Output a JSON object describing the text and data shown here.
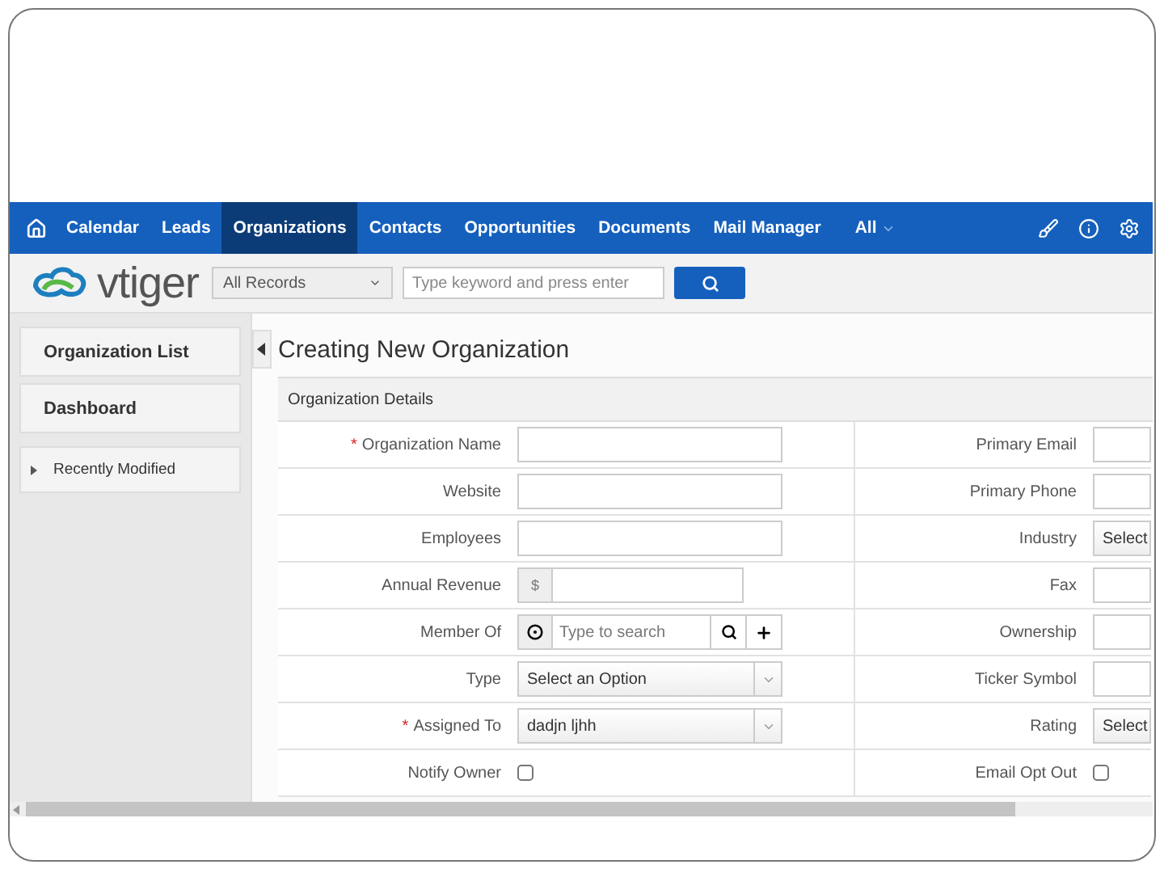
{
  "nav": {
    "items": [
      {
        "label": "Calendar",
        "selected": false
      },
      {
        "label": "Leads",
        "selected": false
      },
      {
        "label": "Organizations",
        "selected": true
      },
      {
        "label": "Contacts",
        "selected": false
      },
      {
        "label": "Opportunities",
        "selected": false
      },
      {
        "label": "Documents",
        "selected": false
      },
      {
        "label": "Mail Manager",
        "selected": false
      }
    ],
    "all_menu": "All"
  },
  "logo": "vtiger",
  "search": {
    "scope": "All Records",
    "placeholder": "Type keyword and press enter"
  },
  "sidebar": {
    "items": [
      {
        "label": "Organization List",
        "kind": "button"
      },
      {
        "label": "Dashboard",
        "kind": "button"
      },
      {
        "label": "Recently Modified",
        "kind": "collapsible"
      }
    ]
  },
  "page_title": "Creating New Organization",
  "section": "Organization Details",
  "left_fields": [
    {
      "required_mark": "*",
      "label": "Organization Name",
      "kind": "text"
    },
    {
      "label": "Website",
      "kind": "text"
    },
    {
      "label": "Employees",
      "kind": "text"
    },
    {
      "label": "Annual Revenue",
      "kind": "currency",
      "prefix": "$"
    },
    {
      "label": "Member Of",
      "kind": "reference",
      "placeholder": "Type to search"
    },
    {
      "label": "Type",
      "kind": "select",
      "value": "Select an Option"
    },
    {
      "required_mark": "*",
      "label": "Assigned To",
      "kind": "select",
      "value": "dadjn ljhh"
    },
    {
      "label": "Notify Owner",
      "kind": "checkbox",
      "checked": false
    }
  ],
  "right_fields": [
    {
      "label": "Primary Email",
      "kind": "text"
    },
    {
      "label": "Primary Phone",
      "kind": "text"
    },
    {
      "label": "Industry",
      "kind": "select",
      "value": "Select"
    },
    {
      "label": "Fax",
      "kind": "text"
    },
    {
      "label": "Ownership",
      "kind": "text"
    },
    {
      "label": "Ticker Symbol",
      "kind": "text"
    },
    {
      "label": "Rating",
      "kind": "select",
      "value": "Select"
    },
    {
      "label": "Email Opt Out",
      "kind": "checkbox",
      "checked": false
    }
  ]
}
